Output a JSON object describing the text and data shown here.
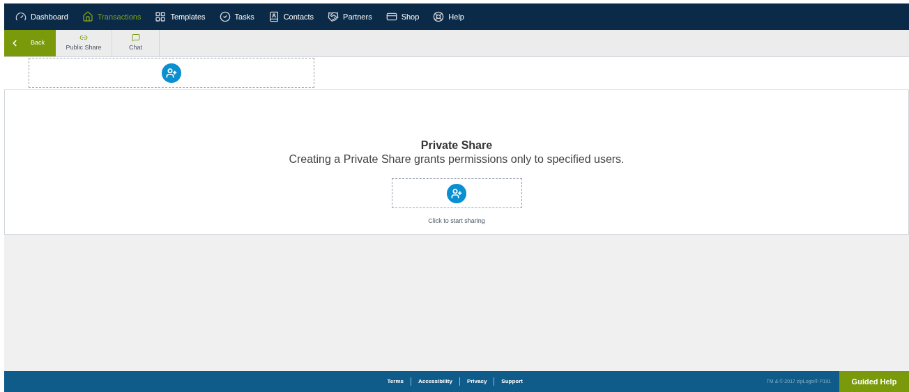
{
  "nav": [
    {
      "label": "Dashboard",
      "selected": false
    },
    {
      "label": "Transactions",
      "selected": true
    },
    {
      "label": "Templates",
      "selected": false
    },
    {
      "label": "Tasks",
      "selected": false
    },
    {
      "label": "Contacts",
      "selected": false
    },
    {
      "label": "Partners",
      "selected": false
    },
    {
      "label": "Shop",
      "selected": false
    },
    {
      "label": "Help",
      "selected": false
    }
  ],
  "toolbar": {
    "back": "Back",
    "items": [
      {
        "label": "Public Share"
      },
      {
        "label": "Chat"
      }
    ]
  },
  "private_share": {
    "title": "Private Share",
    "description": "Creating a Private Share grants permissions only to specified users.",
    "hint": "Click to start sharing"
  },
  "footer": {
    "links": [
      "Terms",
      "Accessibility",
      "Privacy",
      "Support"
    ],
    "copyright": "TM & © 2017 zipLogix® P191",
    "guided_help": "Guided Help"
  }
}
